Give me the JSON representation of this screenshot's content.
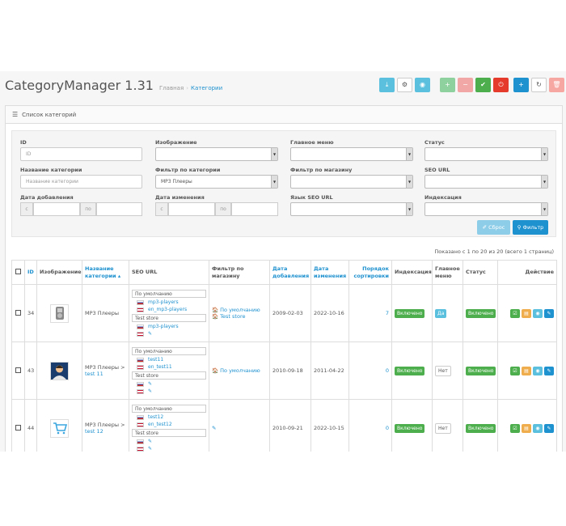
{
  "app": {
    "title": "CategoryManager 1.31"
  },
  "breadcrumb": {
    "home": "Главная",
    "separator": "›",
    "current": "Категории"
  },
  "toolbar": {
    "buttons": [
      {
        "icon": "download-icon",
        "glyph": "⤓",
        "style": "c-info"
      },
      {
        "icon": "cogs-icon",
        "glyph": "⚙",
        "style": "c-def"
      },
      {
        "icon": "eye-icon",
        "glyph": "◉",
        "style": "c-info"
      },
      {
        "icon": "plus-icon",
        "glyph": "+",
        "style": "c-green"
      },
      {
        "icon": "minus-icon",
        "glyph": "−",
        "style": "c-red"
      },
      {
        "icon": "check-icon",
        "glyph": "✔",
        "style": "c-success"
      },
      {
        "icon": "power-icon",
        "glyph": "⏻",
        "style": "c-danger"
      },
      {
        "icon": "plus-icon",
        "glyph": "+",
        "style": "c-blue"
      },
      {
        "icon": "refresh-icon",
        "glyph": "↻",
        "style": "c-def"
      },
      {
        "icon": "trash-icon",
        "glyph": "🗑",
        "style": "c-lred"
      }
    ]
  },
  "panel": {
    "title": "Список категорий",
    "icon_glyph": "☰"
  },
  "filter": {
    "id_label": "ID",
    "id_placeholder": "ID",
    "image_label": "Изображение",
    "main_menu_label": "Главное меню",
    "status_label": "Статус",
    "name_label": "Название категории",
    "name_placeholder": "Название категории",
    "category_filter_label": "Фильтр по категории",
    "category_filter_value": "MP3 Плееры",
    "store_filter_label": "Фильтр по магазину",
    "seo_url_label": "SEO URL",
    "date_added_label": "Дата добавления",
    "date_modified_label": "Дата изменения",
    "seo_lang_label": "Язык SEO URL",
    "indexing_label": "Индексация",
    "from_label": "с",
    "to_label": "по",
    "reset_button": "✐ Сброс",
    "filter_button": "⚲ Фильтр"
  },
  "results_text": "Показано с 1 по 20 из 20 (всего 1 страниц)",
  "table": {
    "headers": {
      "id": "ID",
      "image": "Изображение",
      "name": "Название категории ▴",
      "seo": "SEO URL",
      "store": "Фильтр по магазину",
      "added": "Дата добавления",
      "modified": "Дата изменения",
      "sort": "Порядок сортировки",
      "indexing": "Индексация",
      "menu": "Главное меню",
      "status": "Статус",
      "action": "Действие"
    },
    "rows": [
      {
        "id": "34",
        "image": "ipod",
        "name": "MP3 Плееры",
        "name_link": "",
        "seo_default_label": "По умолчанию",
        "seo_default_ru": "mp3-players",
        "seo_default_en": "en_mp3-players",
        "seo_store_label": "Test store",
        "seo_store_ru": "mp3-players",
        "seo_store_en": "✎",
        "store_1": "🏠 По умолчанию",
        "store_2": "🏠 Test store",
        "added": "2009-02-03",
        "modified": "2022-10-16",
        "sort": "7",
        "indexing": "Включено",
        "menu": "Да",
        "menu_style": "bg-blue",
        "status": "Включено"
      },
      {
        "id": "43",
        "image": "avatar",
        "name": "MP3 Плееры > ",
        "name_link": "test 11",
        "seo_default_label": "По умолчанию",
        "seo_default_ru": "test11",
        "seo_default_en": "en_test11",
        "seo_store_label": "Test store",
        "seo_store_ru": "✎",
        "seo_store_en": "✎",
        "store_1": "🏠 По умолчанию",
        "store_2": "",
        "added": "2010-09-18",
        "modified": "2011-04-22",
        "sort": "0",
        "indexing": "Включено",
        "menu": "Нет",
        "menu_style": "def",
        "status": "Включено"
      },
      {
        "id": "44",
        "image": "cart",
        "name": "MP3 Плееры > ",
        "name_link": "test 12",
        "seo_default_label": "По умолчанию",
        "seo_default_ru": "test12",
        "seo_default_en": "en_test12",
        "seo_store_label": "Test store",
        "seo_store_ru": "✎",
        "seo_store_en": "✎",
        "store_1": "✎",
        "store_2": "",
        "added": "2010-09-21",
        "modified": "2022-10-15",
        "sort": "0",
        "indexing": "Включено",
        "menu": "Нет",
        "menu_style": "def",
        "status": "Включено"
      }
    ],
    "row_actions": [
      {
        "icon": "check-list-icon",
        "glyph": "☑",
        "color": "#4cae4c"
      },
      {
        "icon": "folder-icon",
        "glyph": "▤",
        "color": "#f0ad4e"
      },
      {
        "icon": "eye-icon",
        "glyph": "◉",
        "color": "#5bc0de"
      },
      {
        "icon": "pencil-icon",
        "glyph": "✎",
        "color": "#1e91cf"
      }
    ]
  }
}
